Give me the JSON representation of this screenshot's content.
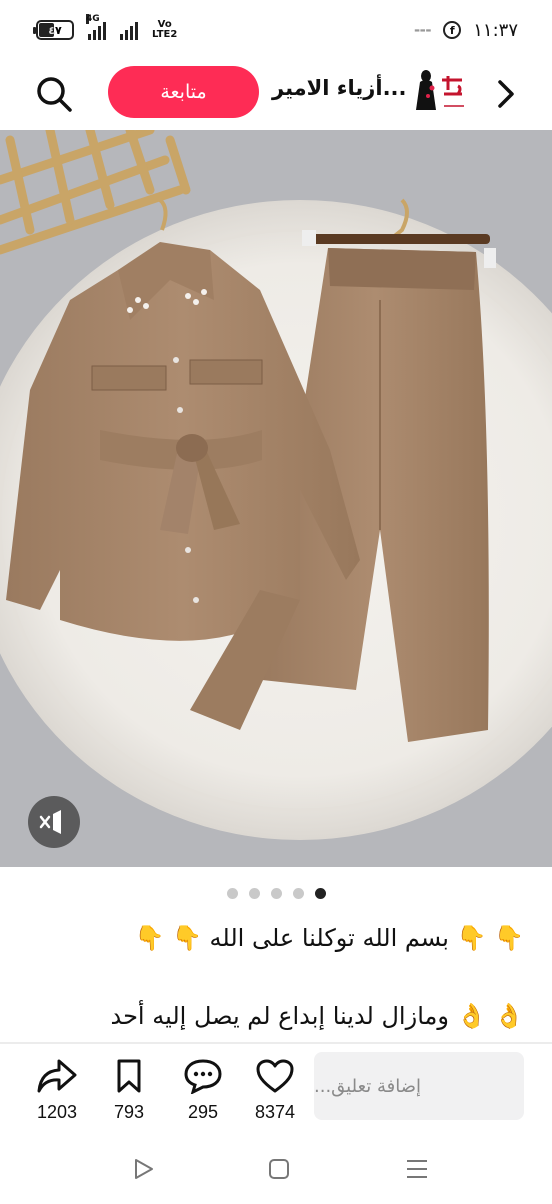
{
  "status_bar": {
    "time": "١١:٣٧",
    "battery_label": "٤٧",
    "battery_level_percent": 47,
    "network_label": "4G",
    "volte_label_1": "Vo",
    "volte_label_2": "LTE2"
  },
  "header": {
    "follow_label": "متابعة",
    "account_name": "أزياء الامير..."
  },
  "media": {
    "image_count": 5,
    "active_index": 4
  },
  "caption": {
    "line1_text": "بسم الله توكلنا على الله",
    "line1_emoji_right": "👇 👇",
    "line1_emoji_left": "👇 👇",
    "line2_text": "ومازال لدينا إبداع لم يصل إليه أحد",
    "line2_emoji_right": "👌 👌"
  },
  "actions": {
    "share_count": "1203",
    "save_count": "793",
    "comment_count": "295",
    "like_count": "8374",
    "comment_placeholder": "إضافة تعليق..."
  },
  "colors": {
    "follow_button": "#fe2c55",
    "garment": "#a8876a",
    "background_photo": "#b6b7bb"
  },
  "icons": [
    "search-icon",
    "back-arrow-icon",
    "share-icon",
    "bookmark-icon",
    "comment-icon",
    "heart-icon",
    "mute-icon",
    "nav-back-icon",
    "nav-home-icon",
    "nav-menu-icon"
  ]
}
